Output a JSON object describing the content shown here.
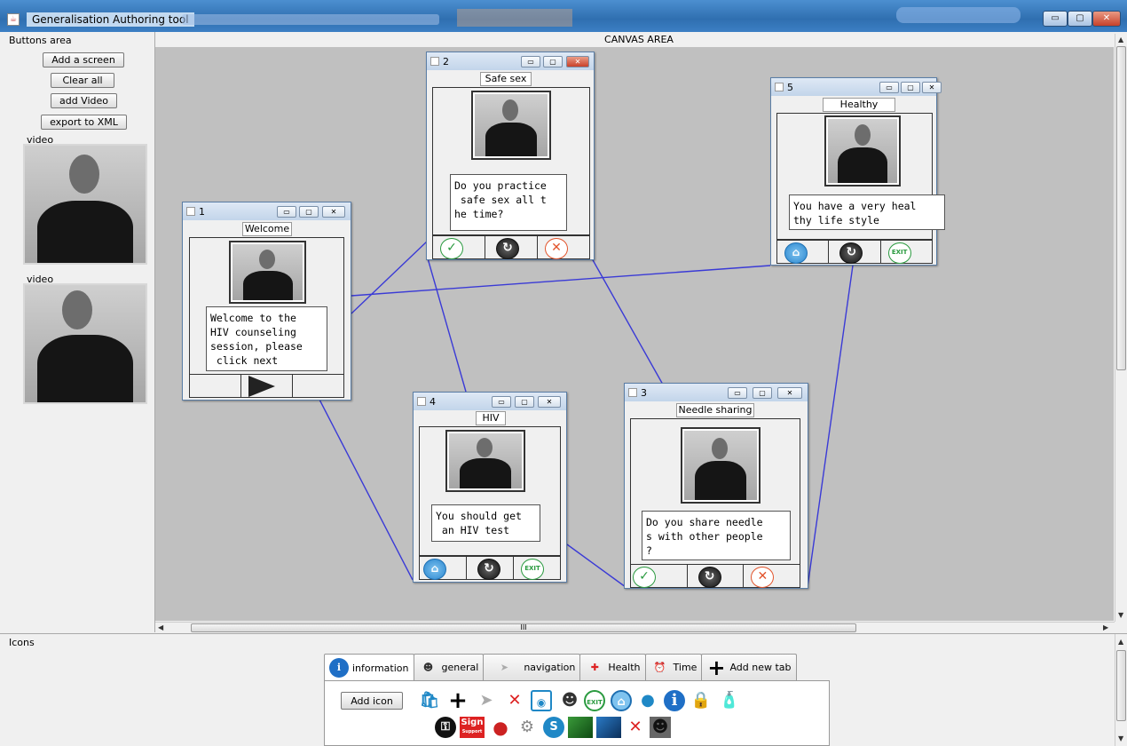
{
  "window": {
    "title": "Generalisation Authoring tool",
    "controls": {
      "minimize": "▭",
      "maximize": "▢",
      "close": "✕"
    }
  },
  "buttons_area": {
    "label": "Buttons area",
    "buttons": [
      "Add a screen",
      "Clear all",
      "add Video",
      "export to XML"
    ],
    "videos": [
      {
        "label": "video"
      },
      {
        "label": "video"
      }
    ]
  },
  "canvas": {
    "header": "CANVAS AREA",
    "scroll_grip": "III",
    "link_color": "#3a3ad6",
    "screens": [
      {
        "id": "screen-1",
        "number": "1",
        "title": "Welcome",
        "text": "Welcome to the\nHIV counseling\nsession, please\n click next",
        "buttons": [
          "",
          "play-icon",
          ""
        ]
      },
      {
        "id": "screen-2",
        "number": "2",
        "title": "Safe sex",
        "text": "Do you practice\n safe sex all t\nhe time?",
        "buttons": [
          "check-icon",
          "refresh-icon",
          "cancel-icon"
        ]
      },
      {
        "id": "screen-3",
        "number": "3",
        "title": "Needle sharing",
        "text": "Do you share needle\ns with other people\n?",
        "buttons": [
          "check-icon",
          "refresh-icon",
          "cancel-icon"
        ]
      },
      {
        "id": "screen-4",
        "number": "4",
        "title": "HIV",
        "text": "You should get\n an HIV test",
        "buttons": [
          "home-icon",
          "refresh-icon",
          "exit-icon"
        ]
      },
      {
        "id": "screen-5",
        "number": "5",
        "title": "Healthy lifestyle",
        "text": "You have a very heal\nthy life style",
        "buttons": [
          "home-icon",
          "refresh-icon",
          "exit-icon"
        ]
      }
    ]
  },
  "icons_panel": {
    "label": "Icons",
    "tabs": [
      {
        "label": "information",
        "icon": "info-icon",
        "active": true
      },
      {
        "label": "general",
        "icon": "person-icon",
        "active": false
      },
      {
        "label": "navigation",
        "icon": "navigation-arrow-icon",
        "active": false
      },
      {
        "label": "Health",
        "icon": "first-aid-icon",
        "active": false
      },
      {
        "label": "Time",
        "icon": "alarm-clock-icon",
        "active": false
      },
      {
        "label": "Add new tab",
        "icon": "plus-icon",
        "active": false
      }
    ],
    "add_icon_label": "Add icon",
    "exit_text": "EXIT",
    "sign_text": "Sign",
    "sign_subtext": "Support",
    "icons_row1": [
      "shopping-bag-add-icon",
      "plus-icon",
      "navigation-arrow-icon",
      "red-x-icon",
      "camera-icon",
      "person-icon",
      "exit-icon",
      "home-icon",
      "user-icon",
      "info-icon",
      "lock-icon",
      "spray-bottle-icon"
    ],
    "icons_row2": [
      "blank-icon",
      "key-icon",
      "sign-support-icon",
      "reset-icon",
      "gears-icon",
      "skype-icon",
      "green-square-icon",
      "blue-square-icon",
      "pencil-cross-icon",
      "person-photo-icon"
    ]
  }
}
